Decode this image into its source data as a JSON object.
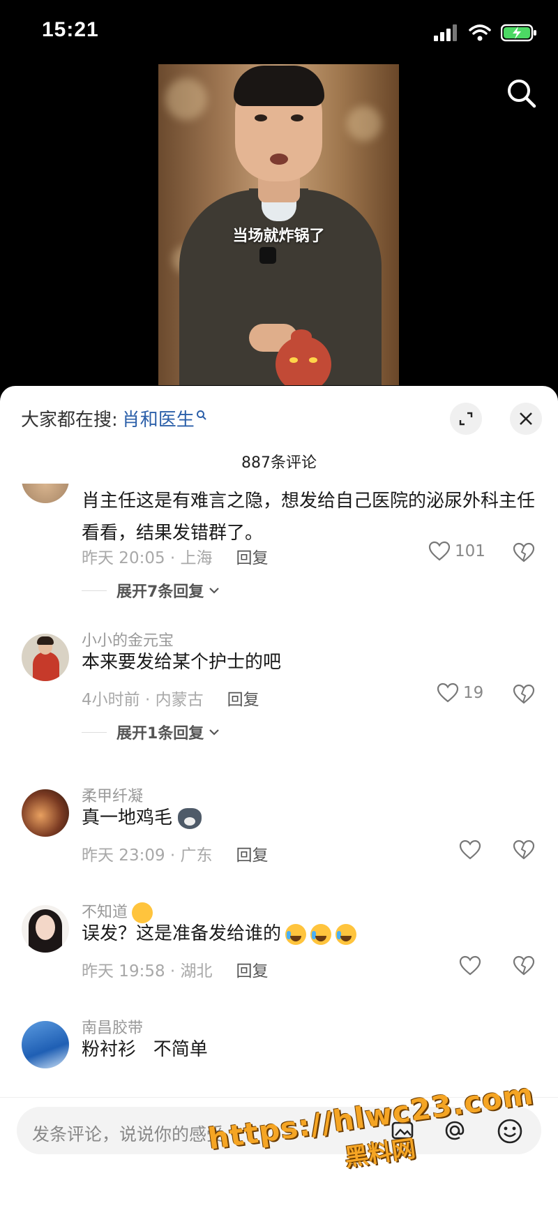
{
  "status_bar": {
    "time": "15:21"
  },
  "video": {
    "subtitle": "当场就炸锅了"
  },
  "sheet": {
    "hot_search_prefix": "大家都在搜:",
    "hot_search_keyword": "肖和医生",
    "comment_count": "887条评论"
  },
  "comments": [
    {
      "text": "肖主任这是有难言之隐，想发给自己医院的泌尿外科主任看看，结果发错群了。",
      "meta": "昨天 20:05 · 上海",
      "reply_label": "回复",
      "likes": "101",
      "expand": "展开7条回复"
    },
    {
      "username": "小小的金元宝",
      "text": "本来要发给某个护士的吧",
      "meta": "4小时前 · 内蒙古",
      "reply_label": "回复",
      "likes": "19",
      "expand": "展开1条回复"
    },
    {
      "username": "柔甲纤凝",
      "text": "真一地鸡毛",
      "meta": "昨天 23:09 · 广东",
      "reply_label": "回复",
      "likes": ""
    },
    {
      "username": "不知道",
      "text": "误发？这是准备发给谁的",
      "meta": "昨天 19:58 · 湖北",
      "reply_label": "回复",
      "likes": ""
    },
    {
      "username": "南昌胶带",
      "text": "粉衬衫   不简单"
    }
  ],
  "input": {
    "placeholder": "发条评论，说说你的感受"
  },
  "watermark": {
    "url": "https://hlwc23.com",
    "name": "黑料网"
  },
  "colors": {
    "accent_link": "#2b5fa9",
    "watermark": "#f5a524"
  }
}
